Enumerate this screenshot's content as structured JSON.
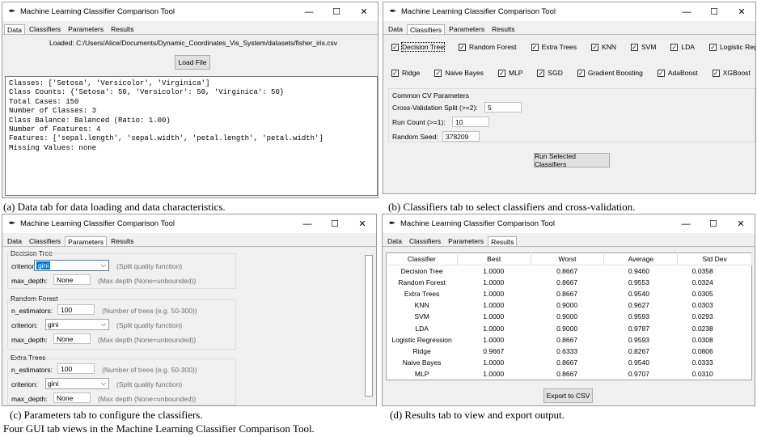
{
  "app_title": "Machine Learning Classifier Comparison Tool",
  "tabs": [
    "Data",
    "Classifiers",
    "Parameters",
    "Results"
  ],
  "window_buttons": {
    "minimize": "—",
    "maximize": "☐",
    "close": "✕"
  },
  "data_tab": {
    "loaded": "Loaded: C:/Users/Alice/Documents/Dynamic_Coordinates_Vis_System/datasets/fisher_iris.csv",
    "load_button": "Load File",
    "info_lines": [
      "Classes: ['Setosa', 'Versicolor', 'Virginica']",
      "Class Counts: {'Setosa': 50, 'Versicolor': 50, 'Virginica': 50}",
      "Total Cases: 150",
      "Number of Classes: 3",
      "Class Balance: Balanced (Ratio: 1.00)",
      "Number of Features: 4",
      "Features: ['sepal.length', 'sepal.width', 'petal.length', 'petal.width']",
      "Missing Values: none"
    ]
  },
  "classifiers_tab": {
    "row1": [
      "Decision Tree",
      "Random Forest",
      "Extra Trees",
      "KNN",
      "SVM",
      "LDA",
      "Logistic Regression"
    ],
    "row2": [
      "Ridge",
      "Naive Bayes",
      "MLP",
      "SGD",
      "Gradient Boosting",
      "AdaBoost",
      "XGBoost"
    ],
    "check_mark": "✓",
    "cv_title": "Common CV Parameters",
    "cv_split_label": "Cross-Validation Split (>=2):",
    "cv_split_value": "5",
    "run_count_label": "Run Count (>=1):",
    "run_count_value": "10",
    "seed_label": "Random Seed:",
    "seed_value": "378209",
    "run_button": "Run Selected Classifiers"
  },
  "parameters_tab": {
    "dt_title": "Decision Tree",
    "rf_title": "Random Forest",
    "et_title": "Extra Trees",
    "criterion_label": "criterion:",
    "max_depth_label": "max_depth:",
    "n_estimators_label": "n_estimators:",
    "criterion_value": "gini",
    "max_depth_value": "None",
    "n_estimators_value": "100",
    "criterion_hint": "(Split quality function)",
    "max_depth_hint": "(Max depth (None=unbounded))",
    "n_estimators_hint": "(Number of trees (e.g. 50-300))"
  },
  "results_tab": {
    "headers": [
      "Classifier",
      "Best",
      "Worst",
      "Average",
      "Std Dev"
    ],
    "rows": [
      [
        "Decision Tree",
        "1.0000",
        "0.8667",
        "0.9460",
        "0.0358"
      ],
      [
        "Random Forest",
        "1.0000",
        "0.8667",
        "0.9553",
        "0.0324"
      ],
      [
        "Extra Trees",
        "1.0000",
        "0.8667",
        "0.9540",
        "0.0305"
      ],
      [
        "KNN",
        "1.0000",
        "0.9000",
        "0.9627",
        "0.0303"
      ],
      [
        "SVM",
        "1.0000",
        "0.9000",
        "0.9593",
        "0.0293"
      ],
      [
        "LDA",
        "1.0000",
        "0.9000",
        "0.9787",
        "0.0238"
      ],
      [
        "Logistic Regression",
        "1.0000",
        "0.8667",
        "0.9593",
        "0.0308"
      ],
      [
        "Ridge",
        "0.9667",
        "0.6333",
        "0.8267",
        "0.0806"
      ],
      [
        "Naive Bayes",
        "1.0000",
        "0.8667",
        "0.9540",
        "0.0333"
      ],
      [
        "MLP",
        "1.0000",
        "0.8667",
        "0.9707",
        "0.0310"
      ]
    ],
    "export_button": "Export to CSV"
  },
  "captions": {
    "a": "(a) Data tab for data loading and data characteristics.",
    "b": "(b) Classifiers tab to select classifiers and cross-validation.",
    "c": "(c) Parameters tab to configure the classifiers.",
    "d": "(d) Results tab to view and export output.",
    "figure": "Four GUI tab views in the Machine Learning Classifier Comparison Tool."
  }
}
